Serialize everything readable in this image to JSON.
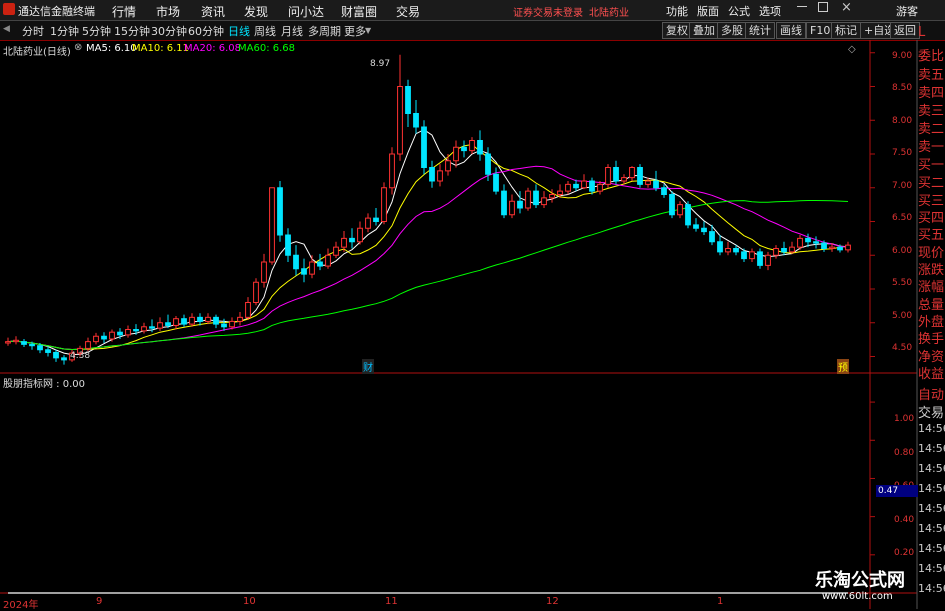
{
  "topbar": {
    "app_title": "通达信金融终端",
    "menu": [
      "行情",
      "市场",
      "资讯",
      "发现",
      "问小达",
      "财富圈",
      "交易"
    ],
    "warning": "证券交易未登录",
    "stock": "北陆药业",
    "right_menu": [
      "功能",
      "版面",
      "公式",
      "选项"
    ],
    "guest": "游客"
  },
  "toolbar": {
    "periods": [
      "分时",
      "1分钟",
      "5分钟",
      "15分钟",
      "30分钟",
      "60分钟",
      "日线",
      "周线",
      "月线",
      "多周期",
      "更多"
    ],
    "active_period": "日线",
    "buttons": [
      "复权",
      "叠加",
      "多股",
      "统计",
      "画线",
      "F10",
      "标记",
      "+自选",
      "返回"
    ]
  },
  "legend": {
    "title": "北陆药业(日线)",
    "ma5": "MA5: 6.10",
    "ma10": "MA10: 6.11",
    "ma20": "MA20: 6.08",
    "ma60": "MA60: 6.68",
    "indicator": "股朋指标网 : 0.00"
  },
  "colors": {
    "up": "#ff3232",
    "down": "#00e5ff",
    "ma5": "#ffffff",
    "ma10": "#ffff00",
    "ma20": "#ff00ff",
    "ma60": "#00ff00",
    "axis": "#b01010"
  },
  "price_axis": [
    "9.00",
    "8.50",
    "8.00",
    "7.50",
    "7.00",
    "6.50",
    "6.00",
    "5.50",
    "5.00",
    "4.50"
  ],
  "indicator_axis": [
    "1.00",
    "0.80",
    "0.60",
    "0.40",
    "0.20"
  ],
  "indicator_value": "0.47",
  "x_labels": [
    "2024年",
    "9",
    "10",
    "11",
    "12",
    "1"
  ],
  "annotations": {
    "high": "8.97",
    "low": "4.38",
    "mark1": "财",
    "mark2": "预"
  },
  "side_panel": [
    "L",
    "委比",
    "卖五",
    "卖四",
    "卖三",
    "卖二",
    "卖一",
    "买一",
    "买二",
    "买三",
    "买四",
    "买五",
    "现价",
    "涨跌",
    "涨幅",
    "总量",
    "外盘",
    "换手",
    "净资",
    "收益"
  ],
  "side_panel2": [
    "自动",
    "交易",
    "14:56",
    "14:56",
    "14:56",
    "14:56",
    "14:56",
    "14:56",
    "14:56",
    "14:56",
    "14:56"
  ],
  "watermark": {
    "title": "乐淘公式网",
    "url": "www.60lt.com"
  },
  "chart_data": {
    "type": "candlestick",
    "ylim": [
      4.3,
      9.1
    ],
    "candles": [
      [
        4.7,
        4.72,
        4.78,
        4.66
      ],
      [
        4.72,
        4.74,
        4.8,
        4.68
      ],
      [
        4.72,
        4.68,
        4.76,
        4.64
      ],
      [
        4.68,
        4.66,
        4.72,
        4.6
      ],
      [
        4.66,
        4.6,
        4.7,
        4.55
      ],
      [
        4.6,
        4.56,
        4.65,
        4.5
      ],
      [
        4.56,
        4.48,
        4.6,
        4.42
      ],
      [
        4.48,
        4.45,
        4.52,
        4.38
      ],
      [
        4.45,
        4.55,
        4.6,
        4.42
      ],
      [
        4.55,
        4.62,
        4.66,
        4.5
      ],
      [
        4.62,
        4.72,
        4.78,
        4.58
      ],
      [
        4.72,
        4.8,
        4.85,
        4.68
      ],
      [
        4.8,
        4.76,
        4.86,
        4.7
      ],
      [
        4.76,
        4.86,
        4.9,
        4.72
      ],
      [
        4.86,
        4.82,
        4.92,
        4.76
      ],
      [
        4.82,
        4.9,
        4.96,
        4.78
      ],
      [
        4.9,
        4.88,
        4.98,
        4.82
      ],
      [
        4.88,
        4.94,
        5.0,
        4.84
      ],
      [
        4.94,
        4.92,
        5.05,
        4.86
      ],
      [
        4.92,
        5.0,
        5.08,
        4.88
      ],
      [
        5.0,
        4.96,
        5.12,
        4.92
      ],
      [
        4.96,
        5.06,
        5.1,
        4.9
      ],
      [
        5.06,
        4.98,
        5.12,
        4.94
      ],
      [
        4.98,
        5.08,
        5.14,
        4.94
      ],
      [
        5.08,
        5.02,
        5.14,
        4.96
      ],
      [
        5.02,
        5.08,
        5.14,
        4.98
      ],
      [
        5.08,
        4.98,
        5.12,
        4.92
      ],
      [
        4.98,
        4.94,
        5.06,
        4.88
      ],
      [
        4.94,
        5.02,
        5.08,
        4.9
      ],
      [
        5.02,
        5.08,
        5.16,
        4.96
      ],
      [
        5.08,
        5.3,
        5.38,
        5.04
      ],
      [
        5.3,
        5.6,
        5.66,
        5.26
      ],
      [
        5.6,
        5.9,
        6.02,
        5.52
      ],
      [
        5.9,
        7.0,
        7.0,
        5.86
      ],
      [
        7.0,
        6.3,
        7.1,
        6.2
      ],
      [
        6.3,
        6.0,
        6.4,
        5.9
      ],
      [
        6.0,
        5.8,
        6.15,
        5.7
      ],
      [
        5.8,
        5.72,
        5.95,
        5.6
      ],
      [
        5.72,
        5.9,
        6.0,
        5.66
      ],
      [
        5.9,
        5.84,
        6.02,
        5.78
      ],
      [
        5.84,
        6.0,
        6.1,
        5.8
      ],
      [
        6.0,
        6.12,
        6.2,
        5.96
      ],
      [
        6.12,
        6.25,
        6.36,
        6.05
      ],
      [
        6.25,
        6.2,
        6.4,
        6.1
      ],
      [
        6.2,
        6.4,
        6.5,
        6.16
      ],
      [
        6.4,
        6.55,
        6.62,
        6.34
      ],
      [
        6.55,
        6.5,
        6.7,
        6.44
      ],
      [
        6.5,
        7.0,
        7.08,
        6.46
      ],
      [
        7.0,
        7.5,
        7.6,
        6.9
      ],
      [
        7.5,
        8.5,
        8.97,
        7.4
      ],
      [
        8.5,
        8.1,
        8.6,
        7.9
      ],
      [
        8.1,
        7.9,
        8.3,
        7.8
      ],
      [
        7.9,
        7.3,
        8.0,
        7.2
      ],
      [
        7.3,
        7.1,
        7.4,
        7.0
      ],
      [
        7.1,
        7.25,
        7.35,
        7.02
      ],
      [
        7.25,
        7.4,
        7.5,
        7.18
      ],
      [
        7.4,
        7.6,
        7.7,
        7.3
      ],
      [
        7.6,
        7.55,
        7.7,
        7.45
      ],
      [
        7.55,
        7.7,
        7.75,
        7.5
      ],
      [
        7.7,
        7.5,
        7.85,
        7.4
      ],
      [
        7.5,
        7.2,
        7.6,
        7.1
      ],
      [
        7.2,
        6.95,
        7.3,
        6.9
      ],
      [
        6.95,
        6.6,
        7.05,
        6.55
      ],
      [
        6.6,
        6.8,
        6.9,
        6.55
      ],
      [
        6.8,
        6.7,
        6.95,
        6.62
      ],
      [
        6.7,
        6.95,
        7.0,
        6.66
      ],
      [
        6.95,
        6.75,
        7.05,
        6.7
      ],
      [
        6.75,
        6.85,
        6.95,
        6.7
      ],
      [
        6.85,
        6.9,
        6.98,
        6.78
      ],
      [
        6.9,
        6.95,
        7.05,
        6.85
      ],
      [
        6.95,
        7.05,
        7.1,
        6.9
      ],
      [
        7.05,
        7.0,
        7.12,
        6.95
      ],
      [
        7.0,
        7.1,
        7.2,
        6.98
      ],
      [
        7.1,
        6.95,
        7.15,
        6.9
      ],
      [
        6.95,
        7.05,
        7.1,
        6.9
      ],
      [
        7.05,
        7.3,
        7.35,
        7.0
      ],
      [
        7.3,
        7.1,
        7.4,
        7.05
      ],
      [
        7.1,
        7.15,
        7.2,
        7.05
      ],
      [
        7.15,
        7.3,
        7.32,
        7.1
      ],
      [
        7.3,
        7.05,
        7.35,
        7.0
      ],
      [
        7.05,
        7.1,
        7.15,
        7.0
      ],
      [
        7.1,
        7.0,
        7.25,
        6.95
      ],
      [
        7.0,
        6.9,
        7.05,
        6.85
      ],
      [
        6.9,
        6.6,
        6.95,
        6.55
      ],
      [
        6.6,
        6.75,
        6.8,
        6.55
      ],
      [
        6.75,
        6.45,
        6.8,
        6.4
      ],
      [
        6.45,
        6.4,
        6.55,
        6.35
      ],
      [
        6.4,
        6.35,
        6.5,
        6.3
      ],
      [
        6.35,
        6.2,
        6.45,
        6.15
      ],
      [
        6.2,
        6.05,
        6.3,
        6.0
      ],
      [
        6.05,
        6.1,
        6.2,
        6.0
      ],
      [
        6.1,
        6.05,
        6.15,
        6.0
      ],
      [
        6.05,
        5.95,
        6.1,
        5.9
      ],
      [
        5.95,
        6.05,
        6.1,
        5.9
      ],
      [
        6.05,
        5.85,
        6.1,
        5.8
      ],
      [
        5.85,
        6.0,
        6.05,
        5.78
      ],
      [
        6.0,
        6.1,
        6.15,
        5.95
      ],
      [
        6.1,
        6.05,
        6.2,
        6.0
      ],
      [
        6.05,
        6.12,
        6.2,
        6.02
      ],
      [
        6.12,
        6.25,
        6.3,
        6.08
      ],
      [
        6.25,
        6.2,
        6.32,
        6.12
      ],
      [
        6.2,
        6.18,
        6.28,
        6.1
      ],
      [
        6.18,
        6.1,
        6.22,
        6.05
      ],
      [
        6.1,
        6.12,
        6.18,
        6.05
      ],
      [
        6.12,
        6.08,
        6.16,
        6.04
      ],
      [
        6.08,
        6.15,
        6.2,
        6.04
      ]
    ],
    "series": [
      {
        "name": "MA5",
        "color": "#ffffff"
      },
      {
        "name": "MA10",
        "color": "#ffff00"
      },
      {
        "name": "MA20",
        "color": "#ff00ff"
      },
      {
        "name": "MA60",
        "color": "#00ff00"
      }
    ],
    "indicator": {
      "ylim": [
        0,
        1.1
      ],
      "values": [
        0,
        0,
        0,
        0,
        0,
        0,
        0,
        0,
        0,
        0,
        0,
        0,
        0,
        0,
        0,
        0,
        0,
        0,
        0,
        0,
        0,
        0,
        0,
        0,
        0,
        0,
        0,
        0,
        0,
        0,
        0,
        0,
        0,
        0,
        0,
        0,
        0,
        0,
        0,
        0,
        0,
        0,
        0,
        0,
        0,
        0,
        0,
        0,
        0,
        0,
        0,
        0,
        0,
        0,
        0,
        0,
        0,
        0,
        0,
        0,
        0,
        0,
        0,
        0,
        0,
        0,
        0,
        0,
        0,
        0,
        0,
        0,
        0,
        0,
        0,
        0,
        0,
        0,
        0,
        0,
        0,
        0,
        0,
        0,
        0,
        0,
        0,
        0,
        0,
        0,
        0,
        0,
        0,
        0,
        0,
        0,
        0,
        0,
        0,
        0,
        0,
        0,
        0,
        0,
        0,
        0
      ]
    }
  }
}
